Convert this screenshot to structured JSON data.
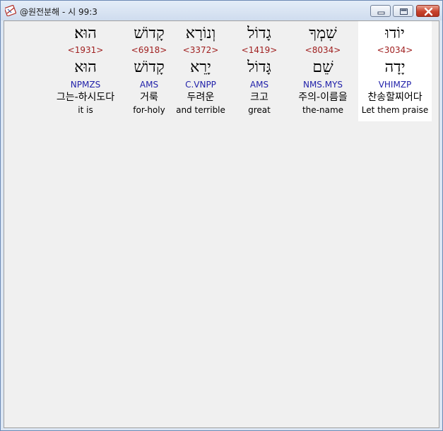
{
  "window": {
    "title": "@원전분해 - 시 99:3",
    "controls": {
      "minimize_icon": "minimize-icon",
      "maximize_icon": "maximize-icon",
      "close_icon": "close-icon"
    },
    "accent_close": "#c8432d"
  },
  "words": [
    {
      "hebrew": "הוּא׃",
      "strong": "<1931>",
      "lemma": "הוּא",
      "morph": "NPMZS",
      "korean": "그는-하시도다",
      "english": "it is",
      "selected": false
    },
    {
      "hebrew": "קָדוֹשׁ",
      "strong": "<6918>",
      "lemma": "קָדוֹשׁ",
      "morph": "AMS",
      "korean": "거룩",
      "english": "for-holy",
      "selected": false
    },
    {
      "hebrew": "וְנוֹרָא",
      "strong": "<3372>",
      "lemma": "יָרֵא",
      "morph": "C.VNPP",
      "korean": "두려운",
      "english": "and terrible",
      "selected": false
    },
    {
      "hebrew": "גָדוֹל",
      "strong": "<1419>",
      "lemma": "גָּדוֹל",
      "morph": "AMS",
      "korean": "크고",
      "english": "great",
      "selected": false
    },
    {
      "hebrew": "שִׁמְךָ",
      "strong": "<8034>",
      "lemma": "שֵׁם",
      "morph": "NMS.MYS",
      "korean": "주의-이름을",
      "english": "the-name",
      "selected": false
    },
    {
      "hebrew": "יוֹדוּ",
      "strong": "<3034>",
      "lemma": "יָדָה",
      "morph": "VHIMZP",
      "korean": "찬송할찌어다",
      "english": "Let them praise",
      "selected": true
    }
  ]
}
